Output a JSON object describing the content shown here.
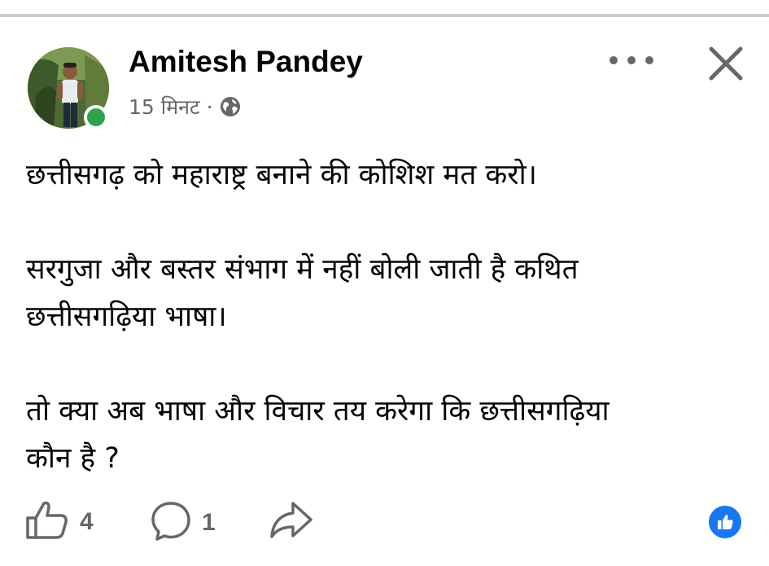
{
  "post": {
    "author": "Amitesh Pandey",
    "timestamp": "15 मिनट",
    "separator": "·",
    "audience_icon": "globe-icon",
    "body": "छत्तीसगढ़ को महाराष्ट्र बनाने की कोशिश मत करो।\n\nसरगुजा और बस्तर संभाग में नहीं बोली जाती है कथित\nछत्तीसगढ़िया भाषा।\n\nतो क्या अब भाषा और विचार तय करेगा कि छत्तीसगढ़िया\nकौन है ?"
  },
  "actions": {
    "like_count": "4",
    "comment_count": "1",
    "like_icon": "thumbs-up-outline-icon",
    "comment_icon": "speech-bubble-icon",
    "share_icon": "share-arrow-icon"
  },
  "header_controls": {
    "more_icon": "more-options-icon",
    "close_icon": "close-icon"
  },
  "reaction": {
    "icon": "like-reaction-icon"
  },
  "colors": {
    "text": "#050505",
    "secondary": "#65676b",
    "online": "#31a24c",
    "brand_blue": "#1877f2",
    "divider": "#c9ccd1"
  }
}
